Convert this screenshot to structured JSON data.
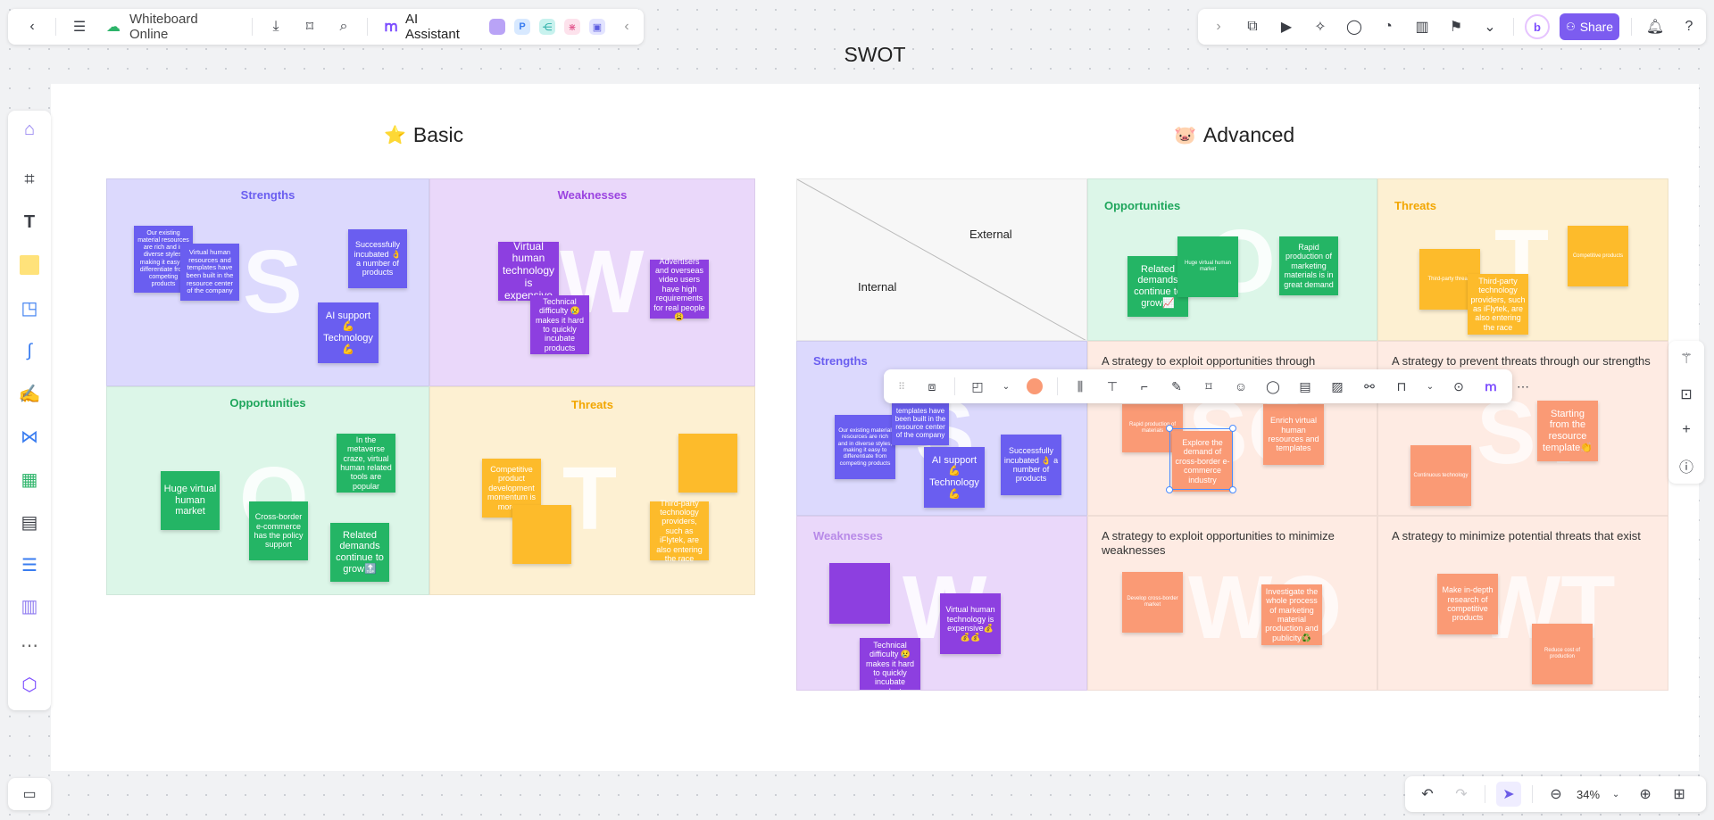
{
  "app": {
    "title": "Whiteboard Online",
    "ai_label": "AI Assistant",
    "share_label": "Share",
    "zoom": "34%"
  },
  "board": {
    "title": "SWOT",
    "basic": {
      "heading": "Basic",
      "strengths": {
        "label": "Strengths",
        "letter": "S",
        "notes": [
          "Our existing material resources are rich and in diverse styles, making it easy to differentiate from competing products",
          "Virtual human resources and templates have been built in the resource center of the company",
          "Successfully incubated 👌 a number of products",
          "AI support 💪 Technology💪"
        ]
      },
      "weaknesses": {
        "label": "Weaknesses",
        "letter": "W",
        "notes": [
          "Virtual human technology is expensive",
          "Technical difficulty 😢 makes it hard to quickly incubate products",
          "Advertisers and overseas video users have high requirements for real people 😩"
        ]
      },
      "opportunities": {
        "label": "Opportunities",
        "letter": "O",
        "notes": [
          "Huge virtual human market",
          "In the metaverse craze, virtual human related tools are popular",
          "Cross-border e-commerce has the policy support",
          "Related demands continue to grow🔝"
        ]
      },
      "threats": {
        "label": "Threats",
        "letter": "T",
        "notes": [
          "Competitive product development momentum is more ...",
          "Third-party technology providers, such as iFlytek, are also entering the race"
        ]
      }
    },
    "advanced": {
      "heading": "Advanced",
      "external_label": "External",
      "internal_label": "Internal",
      "opportunities": {
        "label": "Opportunities",
        "notes": [
          "Related demands continue to grow📈",
          "Rapid production of marketing materials is in great demand"
        ]
      },
      "threats": {
        "label": "Threats",
        "notes": [
          "Third-party technology providers, such as iFlytek, are also entering the race"
        ]
      },
      "strengths": {
        "label": "Strengths",
        "notes": [
          "Our existing material resources are rich and in diverse styles, making it easy to differentiate from competing products",
          "templates have been built in the resource center of the company",
          "AI support 💪 Technology💪",
          "Successfully incubated 👌 a number of products"
        ]
      },
      "weaknesses": {
        "label": "Weaknesses",
        "notes": [
          "Virtual human technology is expensive💰💰💰",
          "Technical difficulty 😢 makes it hard to quickly incubate products"
        ]
      },
      "so": {
        "heading": "A strategy to exploit opportunities through",
        "notes": [
          "Explore the demand of cross-border e-commerce industry",
          "Enrich virtual human resources and templates"
        ]
      },
      "st": {
        "heading": "A strategy to prevent threats through our strengths",
        "notes": [
          "Starting from the resource template👏"
        ]
      },
      "wo": {
        "heading": "A strategy to exploit opportunities to minimize weaknesses",
        "notes": [
          "Investigate the whole process of marketing material production and publicity♻️"
        ]
      },
      "wt": {
        "heading": "A strategy to minimize potential threats that exist",
        "notes": [
          "Make in-depth research of competitive products"
        ]
      }
    }
  },
  "colors": {
    "accent": "#6c5ce7",
    "share": "#7c5cf0",
    "selection": "#4a8cff"
  }
}
